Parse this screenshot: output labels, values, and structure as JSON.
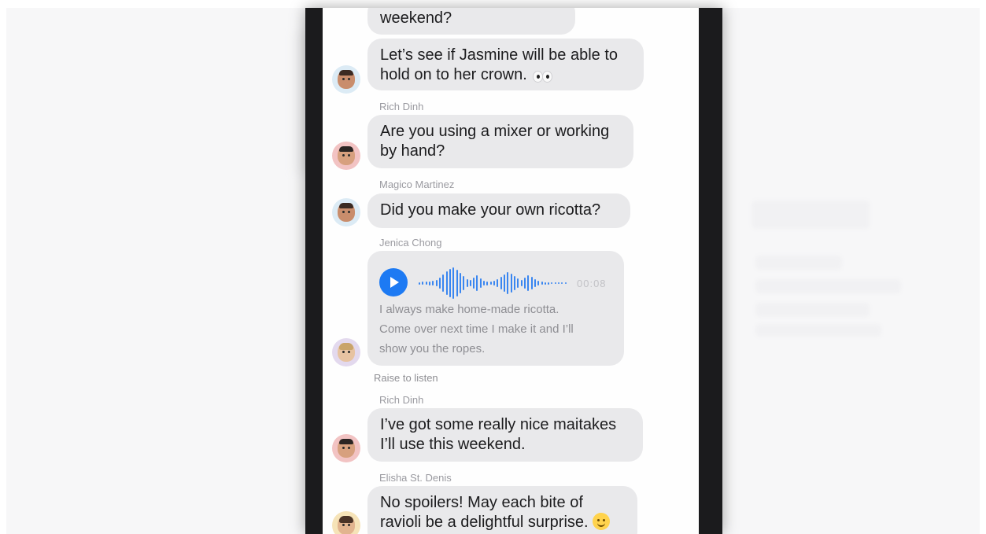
{
  "messages": [
    {
      "sender": "",
      "avatar": "boy",
      "lines": [
        "weekend?"
      ]
    },
    {
      "sender": "",
      "avatar": "boy",
      "lines": [
        "Let’s see if Jasmine will be able to",
        "hold on to her crown."
      ],
      "emoji": "eyes-emoji"
    },
    {
      "sender": "Rich Dinh",
      "avatar": "rich",
      "lines": [
        "Are you using a mixer or working",
        "by hand?"
      ]
    },
    {
      "sender": "Magico Martinez",
      "avatar": "boy",
      "lines": [
        "Did you make your own ricotta?"
      ]
    },
    {
      "sender": "Jenica Chong",
      "avatar": "jenica",
      "audio": {
        "duration": "00:08"
      },
      "transcript": [
        "I always make home-made ricotta.",
        "Come over next time I make it and I’ll",
        "show you the ropes."
      ]
    },
    {
      "sender": "Rich Dinh",
      "avatar": "rich",
      "lines": [
        "I’ve got some really nice maitakes",
        "I’ll use this weekend."
      ]
    },
    {
      "sender": "Elisha St. Denis",
      "avatar": "elisha",
      "lines": [
        "No spoilers! May each bite of",
        "ravioli be a delightful surprise."
      ],
      "emoji": "smiling-face-emoji"
    }
  ],
  "raise_to_listen": "Raise to listen",
  "colors": {
    "bubble": "#e9e9eb",
    "accent": "#1d7af3",
    "sender_text": "#9a9aa0",
    "frame": "#1b1b1d"
  }
}
